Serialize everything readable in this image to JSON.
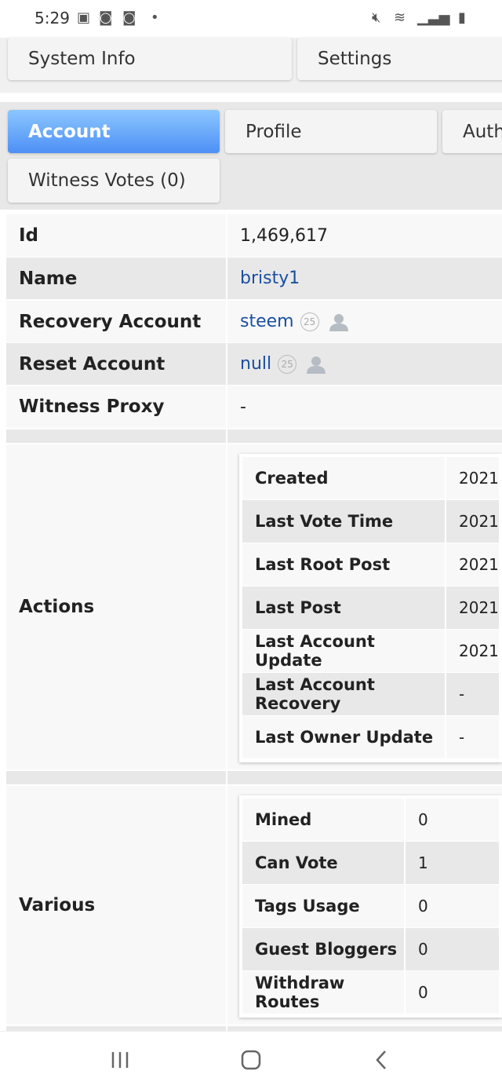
{
  "status_bar": {
    "time": "5:29"
  },
  "top_nav": [
    "System Info",
    "Settings"
  ],
  "tabs": [
    "Account",
    "Profile",
    "Auth",
    "Witness Votes (0)"
  ],
  "account": [
    {
      "label": "Id",
      "value": "1,469,617"
    },
    {
      "label": "Name",
      "value": "bristy1"
    },
    {
      "label": "Recovery Account",
      "value": "steem",
      "badge": "25"
    },
    {
      "label": "Reset Account",
      "value": "null",
      "badge": "25"
    },
    {
      "label": "Witness Proxy",
      "value": "-"
    }
  ],
  "actions": {
    "label": "Actions",
    "rows": [
      {
        "label": "Created",
        "value": "2021-"
      },
      {
        "label": "Last Vote Time",
        "value": "2021-"
      },
      {
        "label": "Last Root Post",
        "value": "2021-"
      },
      {
        "label": "Last Post",
        "value": "2021-"
      },
      {
        "label": "Last Account Update",
        "value": "2021-"
      },
      {
        "label": "Last Account Recovery",
        "value": "-"
      },
      {
        "label": "Last Owner Update",
        "value": "-"
      }
    ]
  },
  "various": {
    "label": "Various",
    "rows": [
      {
        "label": "Mined",
        "value": "0"
      },
      {
        "label": "Can Vote",
        "value": "1"
      },
      {
        "label": "Tags Usage",
        "value": "0"
      },
      {
        "label": "Guest Bloggers",
        "value": "0"
      },
      {
        "label": "Withdraw Routes",
        "value": "0"
      }
    ]
  }
}
